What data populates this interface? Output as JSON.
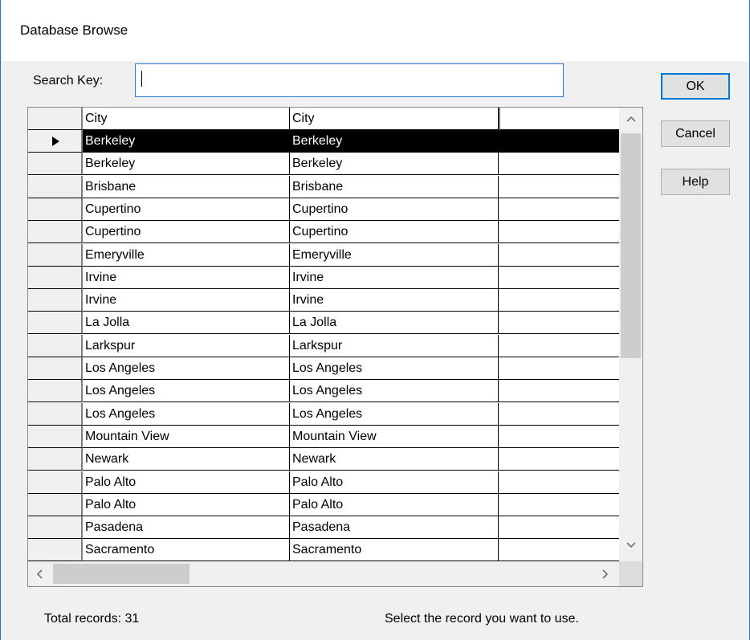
{
  "window": {
    "title": "Database Browse"
  },
  "search": {
    "label": "Search Key:",
    "value": ""
  },
  "buttons": {
    "ok": "OK",
    "cancel": "Cancel",
    "help": "Help"
  },
  "grid": {
    "columns": [
      "City",
      "City",
      ""
    ],
    "selected_index": 0,
    "rows": [
      [
        "Berkeley",
        "Berkeley"
      ],
      [
        "Berkeley",
        "Berkeley"
      ],
      [
        "Brisbane",
        "Brisbane"
      ],
      [
        "Cupertino",
        "Cupertino"
      ],
      [
        "Cupertino",
        "Cupertino"
      ],
      [
        "Emeryville",
        "Emeryville"
      ],
      [
        "Irvine",
        "Irvine"
      ],
      [
        "Irvine",
        "Irvine"
      ],
      [
        "La Jolla",
        "La Jolla"
      ],
      [
        "Larkspur",
        "Larkspur"
      ],
      [
        "Los Angeles",
        "Los Angeles"
      ],
      [
        "Los Angeles",
        "Los Angeles"
      ],
      [
        "Los Angeles",
        "Los Angeles"
      ],
      [
        "Mountain View",
        "Mountain View"
      ],
      [
        "Newark",
        "Newark"
      ],
      [
        "Palo Alto",
        "Palo Alto"
      ],
      [
        "Palo Alto",
        "Palo Alto"
      ],
      [
        "Pasadena",
        "Pasadena"
      ],
      [
        "Sacramento",
        "Sacramento"
      ]
    ]
  },
  "status": {
    "total_records": "Total records: 31",
    "hint": "Select the record you want to use."
  },
  "colors": {
    "accent": "#0078d7",
    "selection": "#000000"
  },
  "icons": {
    "row_indicator": "triangle-right-icon",
    "scroll_up": "chevron-up-icon",
    "scroll_down": "chevron-down-icon",
    "scroll_left": "chevron-left-icon",
    "scroll_right": "chevron-right-icon"
  }
}
